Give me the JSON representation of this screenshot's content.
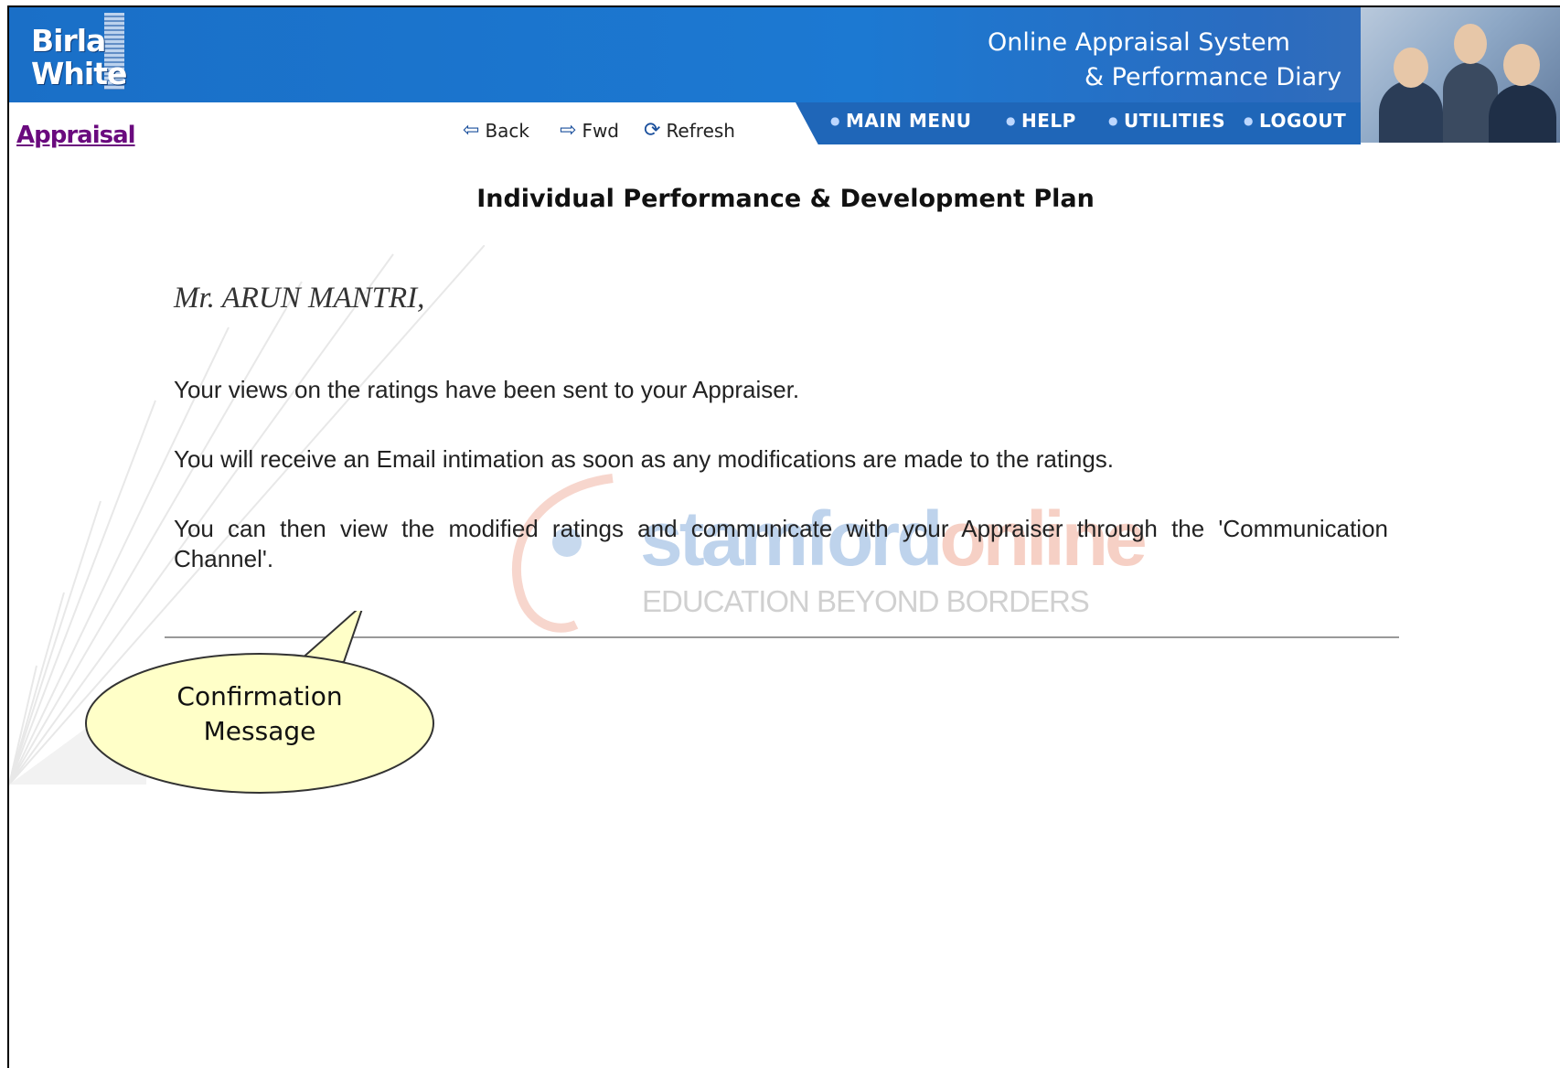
{
  "header": {
    "logo_line1": "Birla",
    "logo_line2": "White",
    "app_title_line1": "Online Appraisal System",
    "app_title_line2": "& Performance Diary"
  },
  "nav": {
    "main_menu": "MAIN MENU",
    "help": "HELP",
    "utilities": "UTILITIES",
    "logout": "LOGOUT"
  },
  "breadcrumb": {
    "section": "Appraisal"
  },
  "toolbar": {
    "back": "Back",
    "fwd": "Fwd",
    "refresh": "Refresh"
  },
  "main": {
    "title": "Individual Performance & Development Plan",
    "greeting": "Mr. ARUN MANTRI,",
    "messages": [
      "Your views on the ratings have been sent to your Appraiser.",
      "You will receive an Email intimation as soon as any modifications are made to the ratings.",
      "You can then view the modified ratings and communicate with your Appraiser through the 'Communication Channel'."
    ]
  },
  "watermark": {
    "brand_part1": "stamford",
    "brand_part2": "online",
    "tagline": "EDUCATION BEYOND BORDERS"
  },
  "callout": {
    "line1": "Confirmation",
    "line2": "Message",
    "fill_color": "#ffffc8"
  },
  "colors": {
    "banner_blue": "#1c79d2",
    "nav_blue": "#1f66b8",
    "appraisal_link": "#6a0a7e"
  },
  "icons": {
    "back": "arrow-left-icon",
    "fwd": "arrow-right-icon",
    "refresh": "refresh-icon"
  }
}
